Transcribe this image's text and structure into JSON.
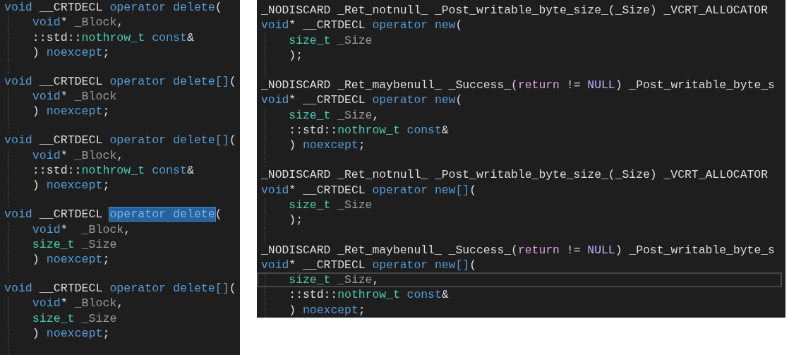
{
  "panes": [
    {
      "lines": [
        {
          "current": false,
          "tokens": [
            {
              "text": "void",
              "kind": "keyword"
            },
            {
              "text": " __CRTDECL ",
              "kind": "plain"
            },
            {
              "text": "operator delete",
              "kind": "keyword"
            },
            {
              "text": "(",
              "kind": "plain"
            }
          ]
        },
        {
          "current": false,
          "tokens": [
            {
              "text": "    void",
              "kind": "keyword"
            },
            {
              "text": "* ",
              "kind": "plain"
            },
            {
              "text": "_Block",
              "kind": "param"
            },
            {
              "text": ",",
              "kind": "plain"
            }
          ]
        },
        {
          "current": false,
          "tokens": [
            {
              "text": "    ::std::",
              "kind": "plain"
            },
            {
              "text": "nothrow_t ",
              "kind": "type"
            },
            {
              "text": "const",
              "kind": "keyword"
            },
            {
              "text": "&",
              "kind": "plain"
            }
          ]
        },
        {
          "current": false,
          "tokens": [
            {
              "text": "    ) ",
              "kind": "plain"
            },
            {
              "text": "noexcept",
              "kind": "keyword"
            },
            {
              "text": ";",
              "kind": "plain"
            }
          ]
        },
        {
          "current": false
        },
        {
          "current": false,
          "tokens": [
            {
              "text": "void",
              "kind": "keyword"
            },
            {
              "text": " __CRTDECL ",
              "kind": "plain"
            },
            {
              "text": "operator delete[]",
              "kind": "keyword"
            },
            {
              "text": "(",
              "kind": "plain"
            }
          ]
        },
        {
          "current": false,
          "tokens": [
            {
              "text": "    void",
              "kind": "keyword"
            },
            {
              "text": "* ",
              "kind": "plain"
            },
            {
              "text": "_Block",
              "kind": "param"
            }
          ]
        },
        {
          "current": false,
          "tokens": [
            {
              "text": "    ) ",
              "kind": "plain"
            },
            {
              "text": "noexcept",
              "kind": "keyword"
            },
            {
              "text": ";",
              "kind": "plain"
            }
          ]
        },
        {
          "current": false
        },
        {
          "current": false,
          "tokens": [
            {
              "text": "void",
              "kind": "keyword"
            },
            {
              "text": " __CRTDECL ",
              "kind": "plain"
            },
            {
              "text": "operator delete[]",
              "kind": "keyword"
            },
            {
              "text": "(",
              "kind": "plain"
            }
          ]
        },
        {
          "current": false,
          "tokens": [
            {
              "text": "    void",
              "kind": "keyword"
            },
            {
              "text": "* ",
              "kind": "plain"
            },
            {
              "text": "_Block",
              "kind": "param"
            },
            {
              "text": ",",
              "kind": "plain"
            }
          ]
        },
        {
          "current": false,
          "tokens": [
            {
              "text": "    ::std::",
              "kind": "plain"
            },
            {
              "text": "nothrow_t ",
              "kind": "type"
            },
            {
              "text": "const",
              "kind": "keyword"
            },
            {
              "text": "&",
              "kind": "plain"
            }
          ]
        },
        {
          "current": false,
          "tokens": [
            {
              "text": "    ) ",
              "kind": "plain"
            },
            {
              "text": "noexcept",
              "kind": "keyword"
            },
            {
              "text": ";",
              "kind": "plain"
            }
          ]
        },
        {
          "current": false
        },
        {
          "current": false,
          "tokens": [
            {
              "text": "void",
              "kind": "keyword"
            },
            {
              "text": " __CRTDECL ",
              "kind": "plain"
            },
            {
              "text": "operator delete",
              "kind": "selection"
            },
            {
              "text": "(",
              "kind": "plain"
            }
          ]
        },
        {
          "current": false,
          "tokens": [
            {
              "text": "    void",
              "kind": "keyword"
            },
            {
              "text": "*  ",
              "kind": "plain"
            },
            {
              "text": "_Block",
              "kind": "param"
            },
            {
              "text": ",",
              "kind": "plain"
            }
          ]
        },
        {
          "current": false,
          "tokens": [
            {
              "text": "    size_t ",
              "kind": "type"
            },
            {
              "text": "_Size",
              "kind": "param"
            }
          ]
        },
        {
          "current": false,
          "tokens": [
            {
              "text": "    ) ",
              "kind": "plain"
            },
            {
              "text": "noexcept",
              "kind": "keyword"
            },
            {
              "text": ";",
              "kind": "plain"
            }
          ]
        },
        {
          "current": false
        },
        {
          "current": false,
          "tokens": [
            {
              "text": "void",
              "kind": "keyword"
            },
            {
              "text": " __CRTDECL ",
              "kind": "plain"
            },
            {
              "text": "operator delete[]",
              "kind": "keyword"
            },
            {
              "text": "(",
              "kind": "plain"
            }
          ]
        },
        {
          "current": false,
          "tokens": [
            {
              "text": "    void",
              "kind": "keyword"
            },
            {
              "text": "* ",
              "kind": "plain"
            },
            {
              "text": "_Block",
              "kind": "param"
            },
            {
              "text": ",",
              "kind": "plain"
            }
          ]
        },
        {
          "current": false,
          "tokens": [
            {
              "text": "    size_t ",
              "kind": "type"
            },
            {
              "text": "_Size",
              "kind": "param"
            }
          ]
        },
        {
          "current": false,
          "tokens": [
            {
              "text": "    ) ",
              "kind": "plain"
            },
            {
              "text": "noexcept",
              "kind": "keyword"
            },
            {
              "text": ";",
              "kind": "plain"
            }
          ]
        },
        {
          "current": false
        }
      ]
    },
    {
      "lines": [
        {
          "current": false,
          "tokens": [
            {
              "text": "_NODISCARD _Ret_notnull_ _Post_writable_byte_size_(_Size) _VCRT_ALLOCATOR",
              "kind": "plain"
            }
          ]
        },
        {
          "current": false,
          "tokens": [
            {
              "text": "void",
              "kind": "keyword"
            },
            {
              "text": "* __CRTDECL ",
              "kind": "plain"
            },
            {
              "text": "operator new",
              "kind": "keyword"
            },
            {
              "text": "(",
              "kind": "plain"
            }
          ]
        },
        {
          "current": false,
          "tokens": [
            {
              "text": "    size_t ",
              "kind": "type"
            },
            {
              "text": "_Size",
              "kind": "param"
            }
          ]
        },
        {
          "current": false,
          "tokens": [
            {
              "text": "    );",
              "kind": "plain"
            }
          ]
        },
        {
          "current": false
        },
        {
          "current": false,
          "tokens": [
            {
              "text": "_NODISCARD _Ret_maybenull_ _Success_(",
              "kind": "plain"
            },
            {
              "text": "return",
              "kind": "control"
            },
            {
              "text": " != ",
              "kind": "plain"
            },
            {
              "text": "NULL",
              "kind": "macro"
            },
            {
              "text": ") _Post_writable_byte_s",
              "kind": "plain"
            }
          ]
        },
        {
          "current": false,
          "tokens": [
            {
              "text": "void",
              "kind": "keyword"
            },
            {
              "text": "* __CRTDECL ",
              "kind": "plain"
            },
            {
              "text": "operator new",
              "kind": "keyword"
            },
            {
              "text": "(",
              "kind": "plain"
            }
          ]
        },
        {
          "current": false,
          "tokens": [
            {
              "text": "    size_t ",
              "kind": "type"
            },
            {
              "text": "_Size",
              "kind": "param"
            },
            {
              "text": ",",
              "kind": "plain"
            }
          ]
        },
        {
          "current": false,
          "tokens": [
            {
              "text": "    ::std::",
              "kind": "plain"
            },
            {
              "text": "nothrow_t ",
              "kind": "type"
            },
            {
              "text": "const",
              "kind": "keyword"
            },
            {
              "text": "&",
              "kind": "plain"
            }
          ]
        },
        {
          "current": false,
          "tokens": [
            {
              "text": "    ) ",
              "kind": "plain"
            },
            {
              "text": "noexcept",
              "kind": "keyword"
            },
            {
              "text": ";",
              "kind": "plain"
            }
          ]
        },
        {
          "current": false
        },
        {
          "current": false,
          "tokens": [
            {
              "text": "_NODISCARD _Ret_notnull_ _Post_writable_byte_size_(_Size) _VCRT_ALLOCATOR",
              "kind": "plain"
            }
          ]
        },
        {
          "current": false,
          "tokens": [
            {
              "text": "void",
              "kind": "keyword"
            },
            {
              "text": "* __CRTDECL ",
              "kind": "plain"
            },
            {
              "text": "operator new[]",
              "kind": "keyword"
            },
            {
              "text": "(",
              "kind": "plain"
            }
          ]
        },
        {
          "current": false,
          "tokens": [
            {
              "text": "    size_t ",
              "kind": "type"
            },
            {
              "text": "_Size",
              "kind": "param"
            }
          ]
        },
        {
          "current": false,
          "tokens": [
            {
              "text": "    );",
              "kind": "plain"
            }
          ]
        },
        {
          "current": false
        },
        {
          "current": false,
          "tokens": [
            {
              "text": "_NODISCARD _Ret_maybenull_ _Success_(",
              "kind": "plain"
            },
            {
              "text": "return",
              "kind": "control"
            },
            {
              "text": " != ",
              "kind": "plain"
            },
            {
              "text": "NULL",
              "kind": "macro"
            },
            {
              "text": ") _Post_writable_byte_s",
              "kind": "plain"
            }
          ]
        },
        {
          "current": false,
          "tokens": [
            {
              "text": "void",
              "kind": "keyword"
            },
            {
              "text": "* __CRTDECL ",
              "kind": "plain"
            },
            {
              "text": "operator new[]",
              "kind": "keyword"
            },
            {
              "text": "(",
              "kind": "plain"
            }
          ]
        },
        {
          "current": true,
          "tokens": [
            {
              "text": "    size_t ",
              "kind": "type"
            },
            {
              "text": "_Size",
              "kind": "param"
            },
            {
              "text": ",",
              "kind": "plain"
            }
          ]
        },
        {
          "current": false,
          "tokens": [
            {
              "text": "    ::std::",
              "kind": "plain"
            },
            {
              "text": "nothrow_t ",
              "kind": "type"
            },
            {
              "text": "const",
              "kind": "keyword"
            },
            {
              "text": "&",
              "kind": "plain"
            }
          ]
        },
        {
          "current": false,
          "tokens": [
            {
              "text": "    ) ",
              "kind": "plain"
            },
            {
              "text": "noexcept",
              "kind": "keyword"
            },
            {
              "text": ";",
              "kind": "plain"
            }
          ]
        }
      ]
    }
  ]
}
